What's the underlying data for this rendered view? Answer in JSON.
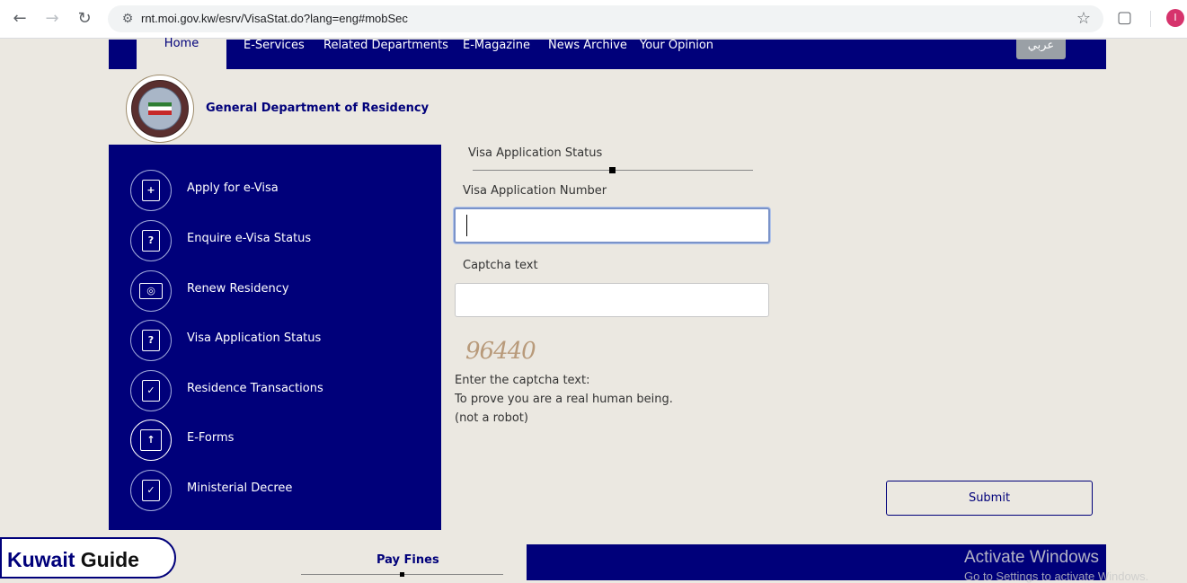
{
  "browser": {
    "url": "rnt.moi.gov.kw/esrv/VisaStat.do?lang=eng#mobSec",
    "profile_initial": "I",
    "icons": [
      "back-icon",
      "forward-icon",
      "reload-icon",
      "site-info-icon",
      "bookmark-star-icon",
      "extensions-icon",
      "profile-avatar"
    ]
  },
  "topnav": {
    "home": "Home",
    "items": [
      "E-Services",
      "Related Departments",
      "E-Magazine",
      "News Archive",
      "Your Opinion"
    ],
    "arabic": "عربي"
  },
  "header": {
    "title": "General Department of Residency"
  },
  "sidebar": {
    "items": [
      {
        "label": "Apply for e-Visa",
        "icon": "+"
      },
      {
        "label": "Enquire e-Visa Status",
        "icon": "?"
      },
      {
        "label": "Renew Residency",
        "icon": "◎"
      },
      {
        "label": "Visa Application Status",
        "icon": "?"
      },
      {
        "label": "Residence Transactions",
        "icon": "✓"
      },
      {
        "label": "E-Forms",
        "icon": "↑"
      },
      {
        "label": "Ministerial Decree",
        "icon": "✓"
      }
    ]
  },
  "form": {
    "section_title": "Visa Application Status",
    "app_number_label": "Visa Application Number",
    "app_number_value": "",
    "captcha_label": "Captcha text",
    "captcha_value": "",
    "captcha_image_text": "96440",
    "hint_1": "Enter the captcha text:",
    "hint_2": "To prove you are a real human being.",
    "hint_3": "(not a robot)",
    "submit": "Submit"
  },
  "footer": {
    "brand_left": "Kuwait ",
    "brand_right": "Guide",
    "pay_fines": "Pay Fines",
    "watermark_title": "Activate Windows",
    "watermark_sub": "Go to Settings to activate Windows."
  },
  "colors": {
    "navy": "#00007a",
    "page_bg": "#ebe8e1"
  }
}
